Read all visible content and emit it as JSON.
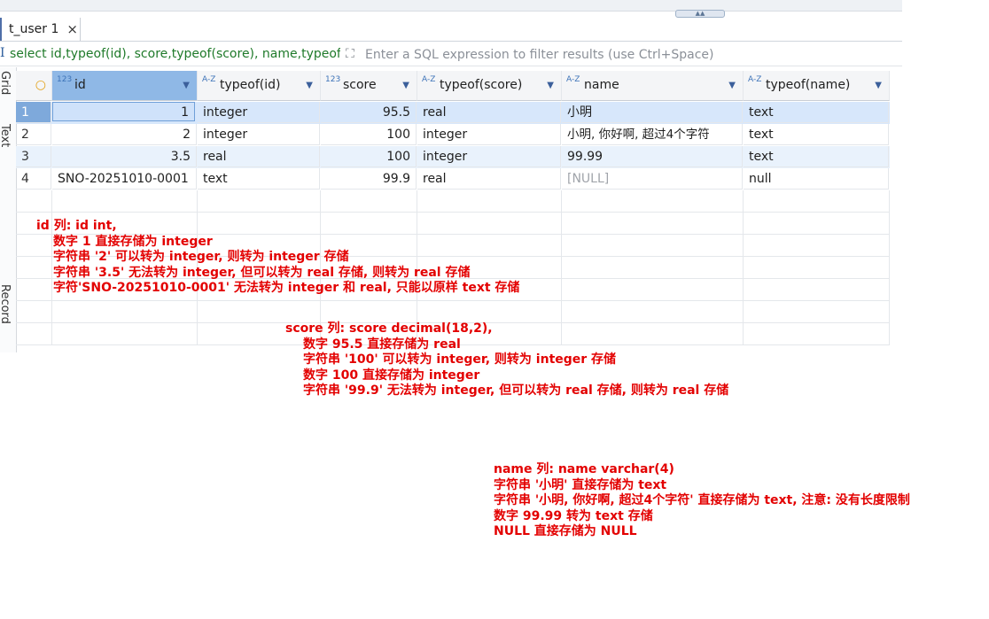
{
  "tab": {
    "label": "t_user 1",
    "close": "×"
  },
  "filter": {
    "sql": "select id,typeof(id), score,typeof(score), name,typeof(name) from t_user",
    "placeholder": "Enter a SQL expression to filter results (use Ctrl+Space)"
  },
  "sidebar": {
    "top_label": "Grid",
    "mid_label": "Text",
    "bottom_label": "Record"
  },
  "columns": [
    {
      "type": "123",
      "label": "id"
    },
    {
      "type": "A-Z",
      "label": "typeof(id)"
    },
    {
      "type": "123",
      "label": "score"
    },
    {
      "type": "A-Z",
      "label": "typeof(score)"
    },
    {
      "type": "A-Z",
      "label": "name"
    },
    {
      "type": "A-Z",
      "label": "typeof(name)"
    }
  ],
  "rows": [
    {
      "num": "1",
      "id": "1",
      "typeof_id": "integer",
      "score": "95.5",
      "typeof_score": "real",
      "name": "小明",
      "typeof_name": "text"
    },
    {
      "num": "2",
      "id": "2",
      "typeof_id": "integer",
      "score": "100",
      "typeof_score": "integer",
      "name": "小明, 你好啊, 超过4个字符",
      "typeof_name": "text"
    },
    {
      "num": "3",
      "id": "3.5",
      "typeof_id": "real",
      "score": "100",
      "typeof_score": "integer",
      "name": "99.99",
      "typeof_name": "text"
    },
    {
      "num": "4",
      "id": "SNO-20251010-0001",
      "typeof_id": "text",
      "score": "99.9",
      "typeof_score": "real",
      "name": "[NULL]",
      "typeof_name": "null"
    }
  ],
  "notes": {
    "id": [
      "id 列: id int,",
      "数字 1 直接存储为 integer",
      "字符串 '2' 可以转为 integer, 则转为 integer 存储",
      "字符串 '3.5' 无法转为 integer, 但可以转为 real 存储, 则转为 real 存储",
      "字符'SNO-20251010-0001' 无法转为 integer 和 real, 只能以原样 text 存储"
    ],
    "score": [
      "score 列: score decimal(18,2),",
      "数字 95.5 直接存储为 real",
      "字符串 '100' 可以转为 integer, 则转为 integer 存储",
      "数字 100 直接存储为 integer",
      "字符串 '99.9' 无法转为 integer, 但可以转为 real 存储, 则转为 real 存储"
    ],
    "name": [
      "name 列: name varchar(4)",
      "字符串 '小明' 直接存储为 text",
      "字符串 '小明, 你好啊, 超过4个字符' 直接存储为 text, 注意: 没有长度限制",
      "数字 99.99 转为 text 存储",
      "NULL 直接存储为 NULL"
    ]
  }
}
